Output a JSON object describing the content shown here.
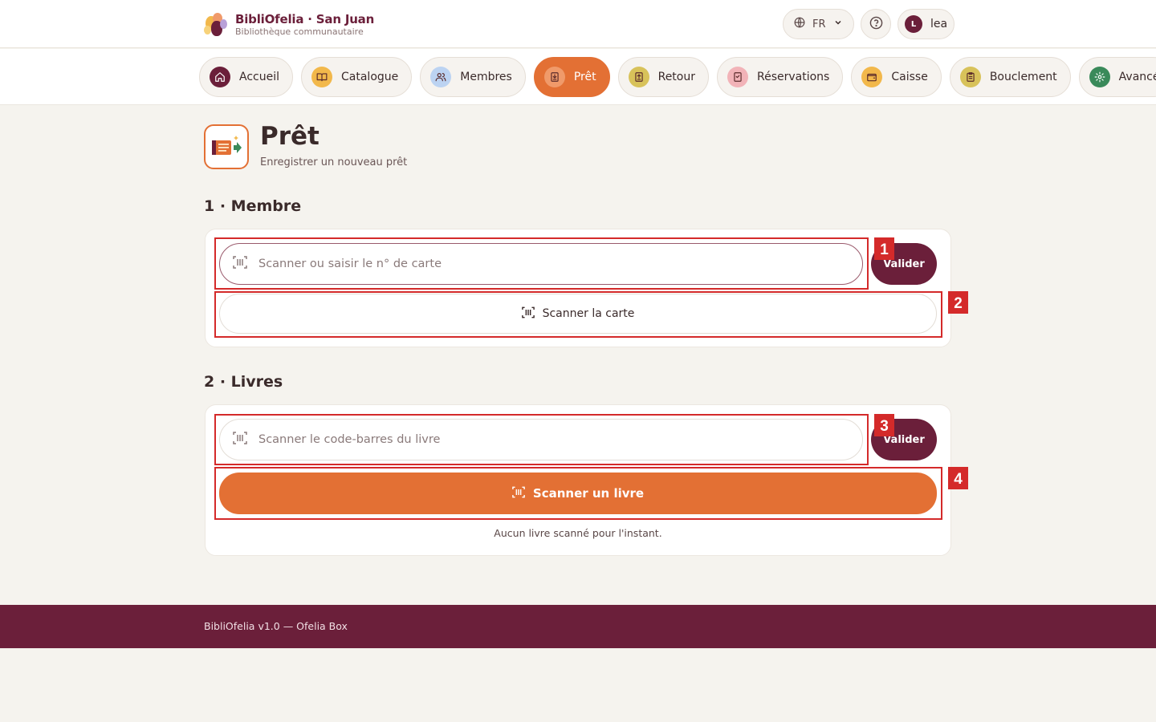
{
  "brand": {
    "name": "BibliOfelia · San Juan",
    "subtitle": "Bibliothèque communautaire"
  },
  "header": {
    "language": "FR",
    "user_initial": "L",
    "user_name": "lea"
  },
  "nav": {
    "tabs": [
      {
        "label": "Accueil",
        "icon": "home-icon",
        "icon_bg": "#6b1f3a",
        "active": false
      },
      {
        "label": "Catalogue",
        "icon": "book-icon",
        "icon_bg": "#f2b84b",
        "active": false
      },
      {
        "label": "Membres",
        "icon": "users-icon",
        "icon_bg": "#bcd3f2",
        "active": false
      },
      {
        "label": "Prêt",
        "icon": "loan-icon",
        "icon_bg": "#f09a6a",
        "active": true
      },
      {
        "label": "Retour",
        "icon": "return-icon",
        "icon_bg": "#d8c25a",
        "active": false
      },
      {
        "label": "Réservations",
        "icon": "bookmark-icon",
        "icon_bg": "#f2b3b8",
        "active": false
      },
      {
        "label": "Caisse",
        "icon": "wallet-icon",
        "icon_bg": "#f2b84b",
        "active": false
      },
      {
        "label": "Bouclement",
        "icon": "clipboard-icon",
        "icon_bg": "#d8c25a",
        "active": false
      },
      {
        "label": "Avancé",
        "icon": "gear-icon",
        "icon_bg": "#3a8a5a",
        "active": false
      }
    ]
  },
  "page": {
    "title": "Prêt",
    "subtitle": "Enregistrer un nouveau prêt"
  },
  "member_section": {
    "title": "1 · Membre",
    "input_placeholder": "Scanner ou saisir le n° de carte",
    "validate_label": "Valider",
    "scan_label": "Scanner la carte"
  },
  "books_section": {
    "title": "2 · Livres",
    "input_placeholder": "Scanner le code-barres du livre",
    "validate_label": "Valider",
    "scan_label": "Scanner un livre",
    "empty_message": "Aucun livre scanné pour l'instant."
  },
  "annotations": [
    "1",
    "2",
    "3",
    "4"
  ],
  "footer": {
    "text": "BibliOfelia v1.0 — Ofelia Box"
  },
  "colors": {
    "primary": "#6b1f3a",
    "accent": "#e37034",
    "background": "#f5f3ee",
    "annotation": "#d42a2a"
  }
}
